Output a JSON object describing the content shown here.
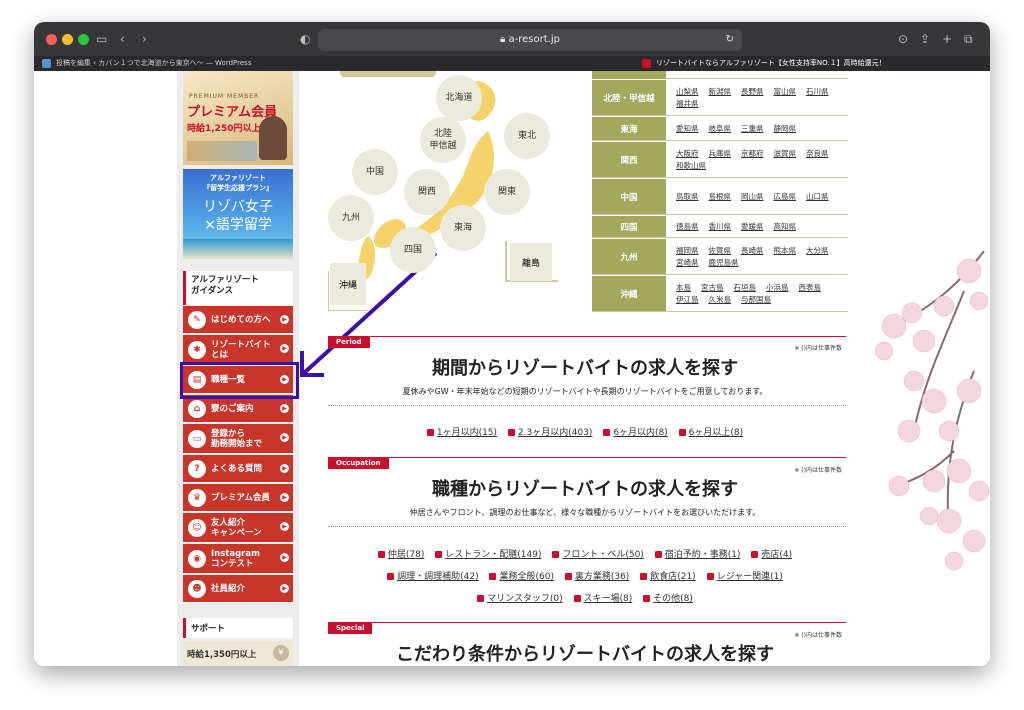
{
  "browser": {
    "url": "a-resort.jp",
    "tabs": [
      {
        "label": "投稿を編集 ‹ カバン１つで北海道から東京へ〜 — WordPress"
      },
      {
        "label": "リゾートバイトならアルファリゾート【女性支持率NO.１】高時給還元！"
      }
    ]
  },
  "sidebar": {
    "promo1": {
      "small": "PREMIUM MEMBER",
      "title": "プレミアム会員",
      "sub": "時給1,250円以上"
    },
    "promo2": {
      "line1": "アルファリゾート",
      "line2": "『留学生応援プラン』",
      "big1": "リゾバ女子",
      "big2": "×語学留学"
    },
    "guidance_title": "アルファリゾート\nガイダンス",
    "menu": [
      {
        "label": "はじめての方へ",
        "icon": "beginner-icon"
      },
      {
        "label": "リゾートバイト\nとは",
        "icon": "palm-tree-icon"
      },
      {
        "label": "職種一覧",
        "icon": "clipboard-icon"
      },
      {
        "label": "寮のご案内",
        "icon": "house-icon"
      },
      {
        "label": "登録から\n勤務開始まで",
        "icon": "monitor-icon"
      },
      {
        "label": "よくある質問",
        "icon": "question-icon"
      },
      {
        "label": "プレミアム会員",
        "icon": "crown-icon"
      },
      {
        "label": "友人紹介\nキャンペーン",
        "icon": "friends-icon"
      },
      {
        "label": "Instagram\nコンテスト",
        "icon": "camera-icon"
      },
      {
        "label": "社員紹介",
        "icon": "staff-icon"
      }
    ],
    "support_title": "サポート",
    "support_banner": "時給1,350円以上"
  },
  "map": {
    "regions": [
      "北海道",
      "北陸\n甲信越",
      "東北",
      "中国",
      "関西",
      "関東",
      "九州",
      "四国",
      "東海",
      "沖縄",
      "離島"
    ]
  },
  "region_table": [
    {
      "name": "北陸・甲信越",
      "prefs": [
        "山梨県",
        "新潟県",
        "長野県",
        "富山県",
        "石川県",
        "福井県"
      ]
    },
    {
      "name": "東海",
      "prefs": [
        "愛知県",
        "岐阜県",
        "三重県",
        "静岡県"
      ]
    },
    {
      "name": "関西",
      "prefs": [
        "大阪府",
        "兵庫県",
        "京都府",
        "滋賀県",
        "奈良県",
        "和歌山県"
      ]
    },
    {
      "name": "中国",
      "prefs": [
        "鳥取県",
        "島根県",
        "岡山県",
        "広島県",
        "山口県"
      ]
    },
    {
      "name": "四国",
      "prefs": [
        "徳島県",
        "香川県",
        "愛媛県",
        "高知県"
      ]
    },
    {
      "name": "九州",
      "prefs": [
        "福岡県",
        "佐賀県",
        "長崎県",
        "熊本県",
        "大分県",
        "宮崎県",
        "鹿児島県"
      ]
    },
    {
      "name": "沖縄",
      "prefs": [
        "本島",
        "宮古島",
        "石垣島",
        "小浜島",
        "西表島",
        "伊江島",
        "久米島",
        "与那国島"
      ]
    }
  ],
  "sections": {
    "period": {
      "tag": "Period",
      "note": "※ ()内は仕事件数",
      "title": "期間からリゾートバイトの求人を探す",
      "desc": "夏休みやGW・年末年始などの短期のリゾートバイトや長期のリゾートバイトをご用意しております。",
      "links": [
        "1ヶ月以内(15)",
        "2.3ヶ月以内(403)",
        "6ヶ月以内(8)",
        "6ヶ月以上(8)"
      ]
    },
    "occupation": {
      "tag": "Occupation",
      "note": "※ ()内は仕事件数",
      "title": "職種からリゾートバイトの求人を探す",
      "desc": "仲居さんやフロント、調理のお仕事など、様々な職種からリゾートバイトをお選びいただけます。",
      "links_row1": [
        "仲居(78)",
        "レストラン・配膳(149)",
        "フロント・ベル(50)",
        "宿泊予約・事務(1)",
        "売店(4)"
      ],
      "links_row2": [
        "調理・調理補助(42)",
        "業務全般(60)",
        "裏方業務(36)",
        "飲食店(21)",
        "レジャー関連(1)"
      ],
      "links_row3": [
        "マリンスタッフ(0)",
        "スキー場(8)",
        "その他(8)"
      ]
    },
    "special": {
      "tag": "Special",
      "note": "※ ()内は仕事件数",
      "title": "こだわり条件からリゾートバイトの求人を探す"
    }
  },
  "colors": {
    "accent_red": "#c8102e",
    "menu_red": "#c8352a",
    "region_olive": "#a2a85e",
    "highlight_purple": "#3d0fa8"
  }
}
